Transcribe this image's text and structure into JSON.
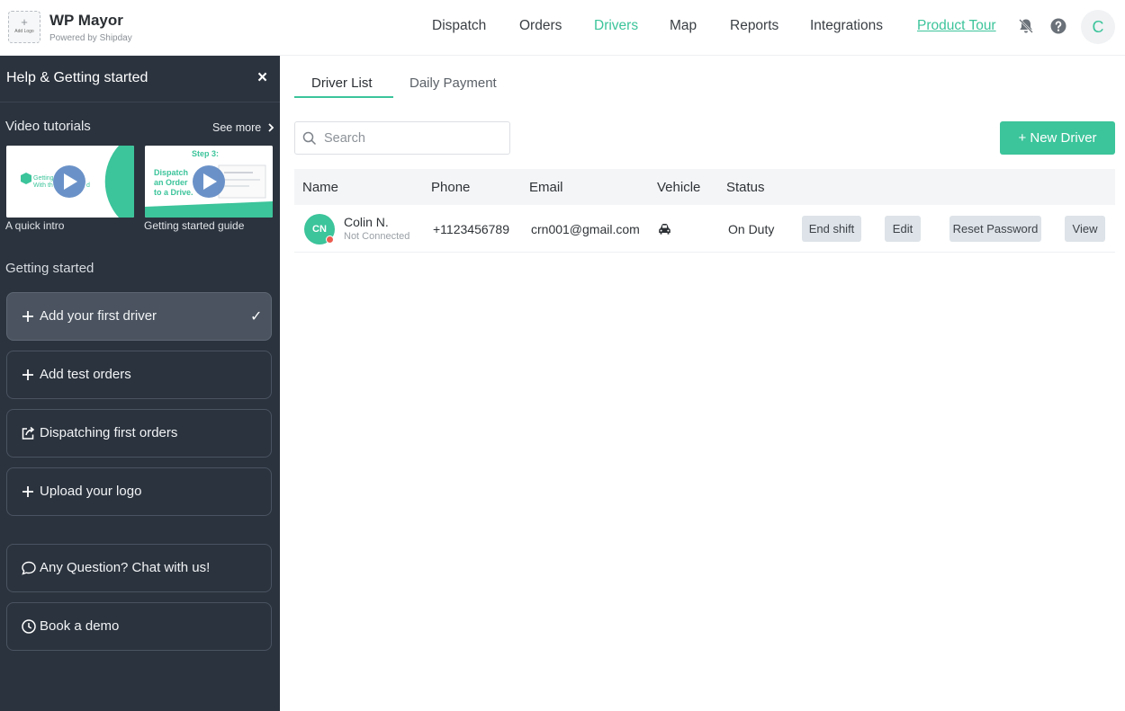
{
  "header": {
    "logo_plus": "+",
    "logo_caption": "Add Logo",
    "brand_name": "WP Mayor",
    "brand_sub": "Powered by Shipday",
    "nav": [
      {
        "label": "Dispatch"
      },
      {
        "label": "Orders"
      },
      {
        "label": "Drivers",
        "active": true
      },
      {
        "label": "Map"
      },
      {
        "label": "Reports"
      },
      {
        "label": "Integrations"
      },
      {
        "label": "Product Tour"
      }
    ],
    "icons": [
      "bell-off-icon",
      "help-icon"
    ],
    "avatar_initial": "C",
    "accent": "#3cc49a"
  },
  "sidebar": {
    "title": "Help & Getting started",
    "close_label": "×",
    "video_tutorials": {
      "title": "Video tutorials",
      "see_more": "See more",
      "videos": [
        {
          "caption": "A quick intro",
          "thumb_text_1": "Getting",
          "thumb_text_2": "With th",
          "thumb_text_3": "d"
        },
        {
          "caption": "Getting started guide",
          "thumb_step": "Step 3:",
          "thumb_line_1": "Dispatch",
          "thumb_line_2": "an Order",
          "thumb_line_3": "to a Drive."
        }
      ]
    },
    "getting_started": {
      "title": "Getting started",
      "items": [
        {
          "label": "Add your first driver",
          "icon": "plus-icon",
          "done": true
        },
        {
          "label": "Add test orders",
          "icon": "plus-icon"
        },
        {
          "label": "Dispatching first orders",
          "icon": "share-icon"
        },
        {
          "label": "Upload your logo",
          "icon": "plus-icon"
        }
      ]
    },
    "support": [
      {
        "label": "Any Question? Chat with us!",
        "icon": "chat-icon"
      },
      {
        "label": "Book a demo",
        "icon": "clock-icon"
      }
    ],
    "check_mark": "✓"
  },
  "main": {
    "tabs": [
      {
        "label": "Driver List",
        "active": true
      },
      {
        "label": "Daily Payment"
      }
    ],
    "search": {
      "placeholder": "Search",
      "value": ""
    },
    "new_driver_label": "+ New Driver",
    "table": {
      "headers": [
        "Name",
        "Phone",
        "Email",
        "Vehicle",
        "Status"
      ],
      "rows": [
        {
          "initials": "CN",
          "name": "Colin N.",
          "connection": "Not Connected",
          "phone": "+1123456789",
          "email": "crn001@gmail.com",
          "vehicle_icon": "car-icon",
          "status": "On Duty",
          "actions": [
            "End shift",
            "Edit",
            "Reset Password",
            "View"
          ]
        }
      ]
    }
  }
}
